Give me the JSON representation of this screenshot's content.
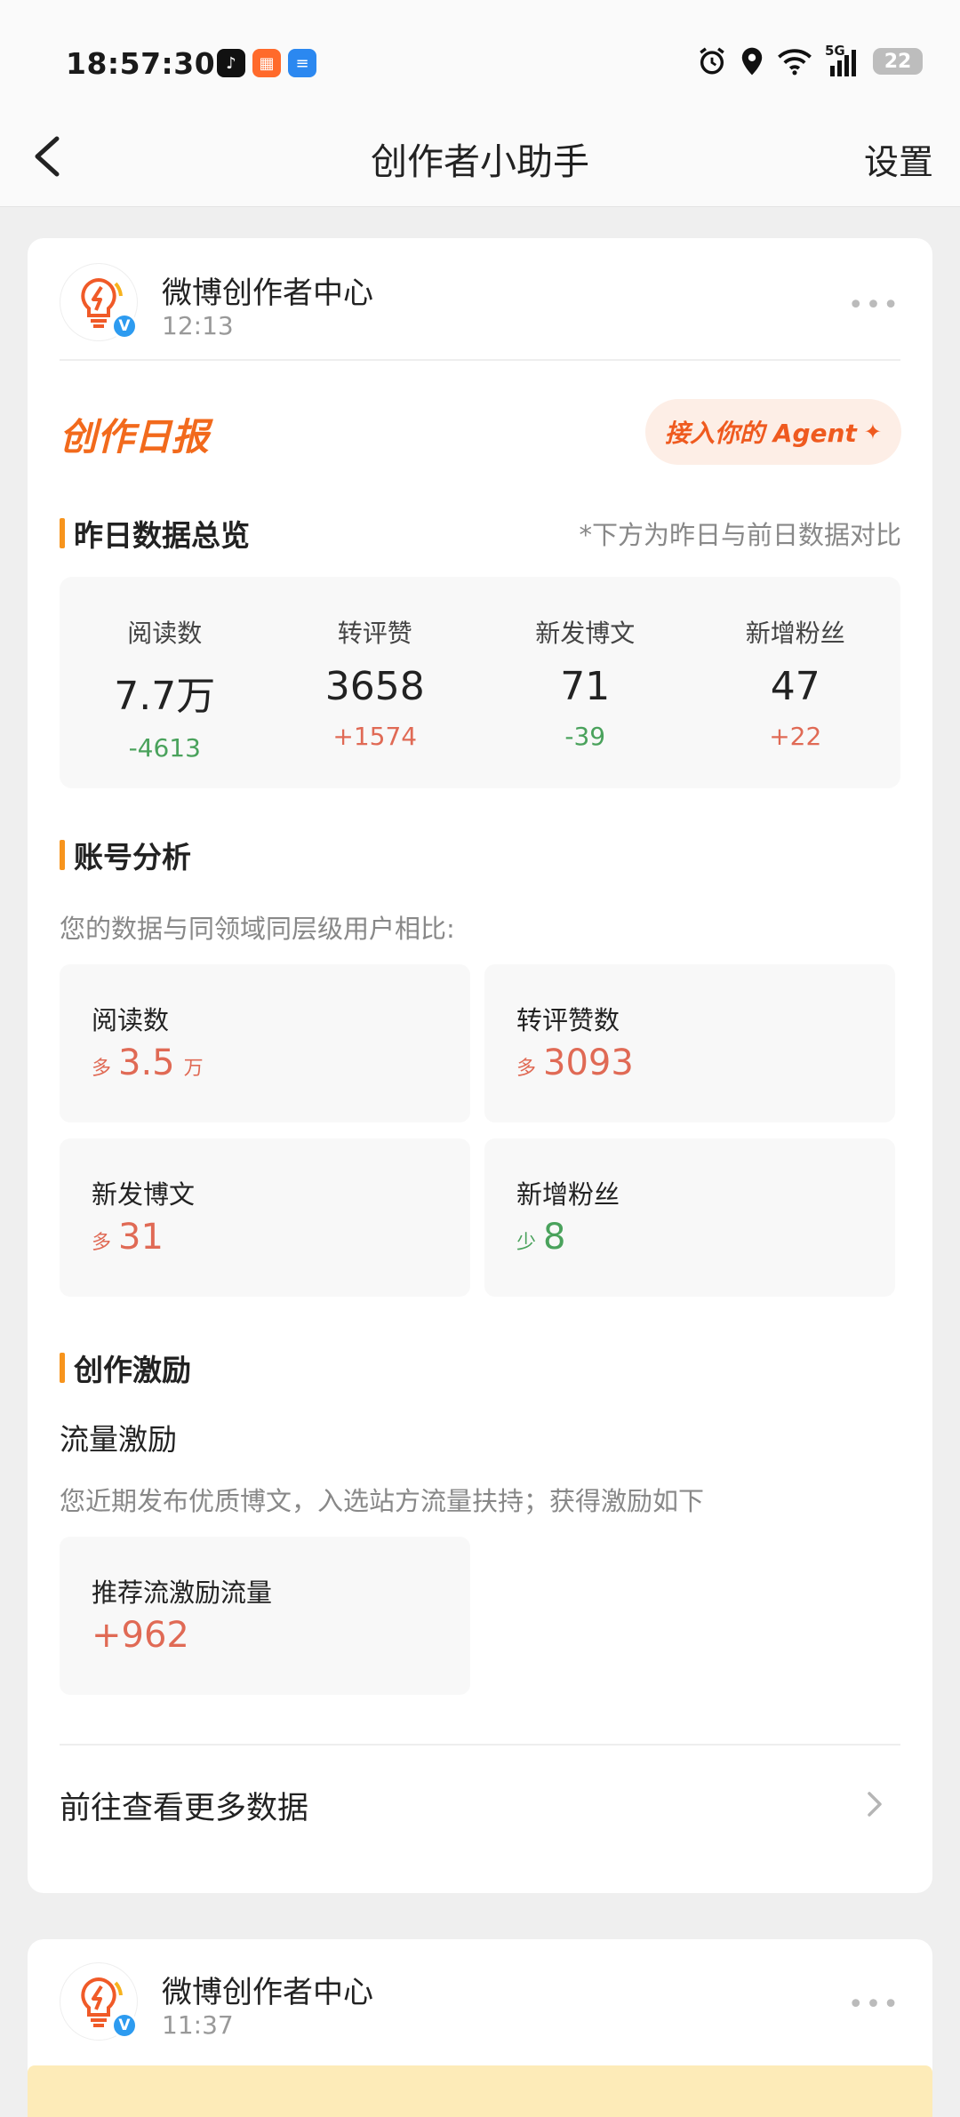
{
  "status_bar": {
    "time": "18:57:30",
    "network": "5G",
    "battery": "22"
  },
  "nav": {
    "title": "创作者小助手",
    "settings": "设置"
  },
  "message1": {
    "sender": "微博创作者中心",
    "time": "12:13",
    "report_title": "创作日报",
    "agent_button": "接入你的 Agent",
    "overview": {
      "heading": "昨日数据总览",
      "note": "*下方为昨日与前日数据对比",
      "items": [
        {
          "label": "阅读数",
          "value": "7.7万",
          "delta": "-4613",
          "trend": "down"
        },
        {
          "label": "转评赞",
          "value": "3658",
          "delta": "+1574",
          "trend": "up"
        },
        {
          "label": "新发博文",
          "value": "71",
          "delta": "-39",
          "trend": "down"
        },
        {
          "label": "新增粉丝",
          "value": "47",
          "delta": "+22",
          "trend": "up"
        }
      ]
    },
    "analysis": {
      "heading": "账号分析",
      "desc": "您的数据与同领域同层级用户相比:",
      "items": [
        {
          "label": "阅读数",
          "prefix": "多",
          "value": "3.5",
          "suffix": "万"
        },
        {
          "label": "转评赞数",
          "prefix": "多",
          "value": "3093",
          "suffix": ""
        },
        {
          "label": "新发博文",
          "prefix": "多",
          "value": "31",
          "suffix": ""
        },
        {
          "label": "新增粉丝",
          "prefix": "少",
          "value": "8",
          "suffix": ""
        }
      ]
    },
    "incentive": {
      "heading": "创作激励",
      "subheading": "流量激励",
      "desc": "您近期发布优质博文，入选站方流量扶持；获得激励如下",
      "box_label": "推荐流激励流量",
      "box_value": "+962"
    },
    "more_link": "前往查看更多数据"
  },
  "message2": {
    "sender": "微博创作者中心",
    "time": "11:37"
  },
  "colors": {
    "accent_orange": "#f26a1c",
    "increase": "#e06a55",
    "decrease": "#4aa25c",
    "verified_blue": "#2d9bf0"
  }
}
